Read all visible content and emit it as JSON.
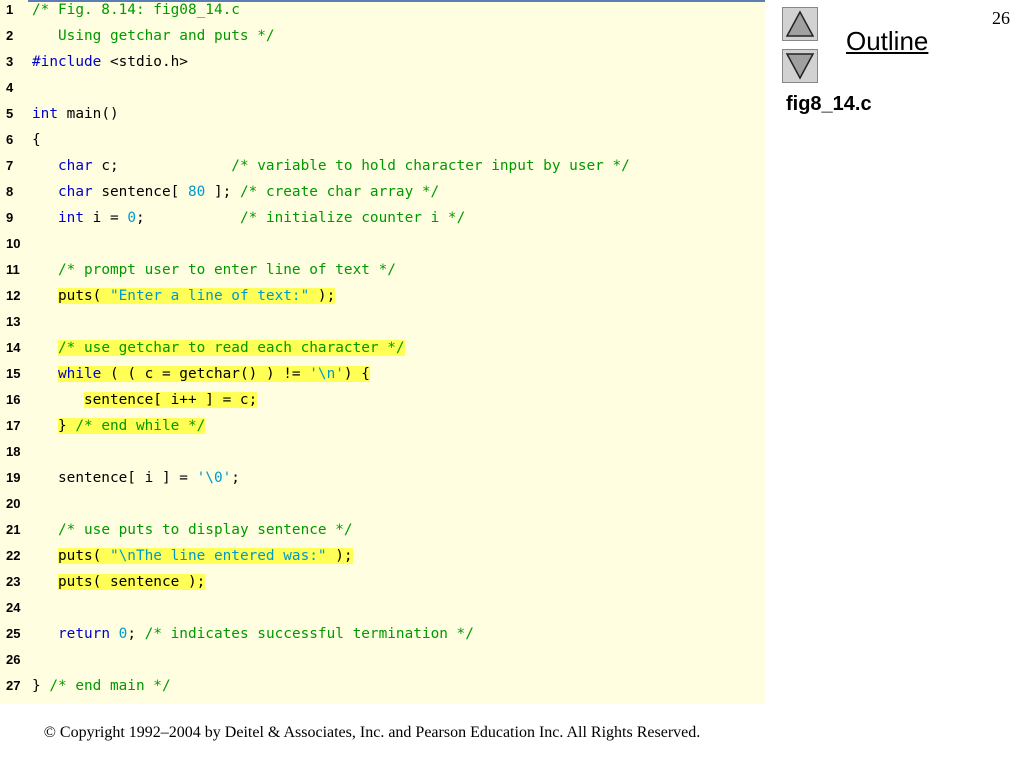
{
  "slide_number": "26",
  "outline": {
    "label": "Outline",
    "up_icon": "up-triangle-icon",
    "down_icon": "down-triangle-icon"
  },
  "file_label": "fig8_14.c",
  "copyright": "© Copyright 1992–2004 by Deitel & Associates, Inc. and Pearson Education Inc. All Rights Reserved.",
  "colors": {
    "panel": "#fffee0",
    "highlight": "#ffff55",
    "keyword": "#0000cc",
    "comment": "#009900",
    "literal": "#0099cc"
  },
  "code": {
    "lines": [
      {
        "n": "1",
        "hl": false,
        "tokens": [
          {
            "t": "cm",
            "v": "/* Fig. 8.14: fig08_14.c"
          }
        ]
      },
      {
        "n": "2",
        "hl": false,
        "tokens": [
          {
            "t": "cm",
            "v": "   Using getchar and puts */"
          }
        ]
      },
      {
        "n": "3",
        "hl": false,
        "tokens": [
          {
            "t": "kw",
            "v": "#include"
          },
          {
            "t": "tx",
            "v": " <stdio.h>"
          }
        ]
      },
      {
        "n": "4",
        "hl": false,
        "tokens": []
      },
      {
        "n": "5",
        "hl": false,
        "tokens": [
          {
            "t": "kw",
            "v": "int"
          },
          {
            "t": "tx",
            "v": " main()"
          }
        ]
      },
      {
        "n": "6",
        "hl": false,
        "tokens": [
          {
            "t": "tx",
            "v": "{"
          }
        ]
      },
      {
        "n": "7",
        "hl": false,
        "tokens": [
          {
            "t": "tx",
            "v": "   "
          },
          {
            "t": "kw",
            "v": "char"
          },
          {
            "t": "tx",
            "v": " c;             "
          },
          {
            "t": "cm",
            "v": "/* variable to hold character input by user */"
          }
        ]
      },
      {
        "n": "8",
        "hl": false,
        "tokens": [
          {
            "t": "tx",
            "v": "   "
          },
          {
            "t": "kw",
            "v": "char"
          },
          {
            "t": "tx",
            "v": " sentence[ "
          },
          {
            "t": "lit",
            "v": "80"
          },
          {
            "t": "tx",
            "v": " ]; "
          },
          {
            "t": "cm",
            "v": "/* create char array */"
          }
        ]
      },
      {
        "n": "9",
        "hl": false,
        "tokens": [
          {
            "t": "tx",
            "v": "   "
          },
          {
            "t": "kw",
            "v": "int"
          },
          {
            "t": "tx",
            "v": " i = "
          },
          {
            "t": "lit",
            "v": "0"
          },
          {
            "t": "tx",
            "v": ";           "
          },
          {
            "t": "cm",
            "v": "/* initialize counter i */"
          }
        ]
      },
      {
        "n": "10",
        "hl": false,
        "tokens": []
      },
      {
        "n": "11",
        "hl": false,
        "tokens": [
          {
            "t": "tx",
            "v": "   "
          },
          {
            "t": "cm",
            "v": "/* prompt user to enter line of text */"
          }
        ]
      },
      {
        "n": "12",
        "hl": true,
        "tokens": [
          {
            "t": "tx",
            "v": "   puts( "
          },
          {
            "t": "lit",
            "v": "\"Enter a line of text:\""
          },
          {
            "t": "tx",
            "v": " );"
          }
        ]
      },
      {
        "n": "13",
        "hl": false,
        "tokens": []
      },
      {
        "n": "14",
        "hl": true,
        "tokens": [
          {
            "t": "tx",
            "v": "   "
          },
          {
            "t": "cm",
            "v": "/* use getchar to read each character */"
          }
        ]
      },
      {
        "n": "15",
        "hl": true,
        "tokens": [
          {
            "t": "tx",
            "v": "   "
          },
          {
            "t": "kw",
            "v": "while"
          },
          {
            "t": "tx",
            "v": " ( ( c = getchar() ) != "
          },
          {
            "t": "lit",
            "v": "'\\n'"
          },
          {
            "t": "tx",
            "v": ") {"
          }
        ]
      },
      {
        "n": "16",
        "hl": true,
        "tokens": [
          {
            "t": "tx",
            "v": "      sentence[ i++ ] = c;"
          }
        ]
      },
      {
        "n": "17",
        "hl": true,
        "tokens": [
          {
            "t": "tx",
            "v": "   } "
          },
          {
            "t": "cm",
            "v": "/* end while */"
          }
        ]
      },
      {
        "n": "18",
        "hl": false,
        "tokens": []
      },
      {
        "n": "19",
        "hl": false,
        "tokens": [
          {
            "t": "tx",
            "v": "   sentence[ i ] = "
          },
          {
            "t": "lit",
            "v": "'\\0'"
          },
          {
            "t": "tx",
            "v": ";"
          }
        ]
      },
      {
        "n": "20",
        "hl": false,
        "tokens": []
      },
      {
        "n": "21",
        "hl": false,
        "tokens": [
          {
            "t": "tx",
            "v": "   "
          },
          {
            "t": "cm",
            "v": "/* use puts to display sentence */"
          }
        ]
      },
      {
        "n": "22",
        "hl": true,
        "tokens": [
          {
            "t": "tx",
            "v": "   puts( "
          },
          {
            "t": "lit",
            "v": "\"\\nThe line entered was:\""
          },
          {
            "t": "tx",
            "v": " );"
          }
        ]
      },
      {
        "n": "23",
        "hl": true,
        "tokens": [
          {
            "t": "tx",
            "v": "   puts( sentence );"
          }
        ]
      },
      {
        "n": "24",
        "hl": false,
        "tokens": []
      },
      {
        "n": "25",
        "hl": false,
        "tokens": [
          {
            "t": "tx",
            "v": "   "
          },
          {
            "t": "kw",
            "v": "return"
          },
          {
            "t": "tx",
            "v": " "
          },
          {
            "t": "lit",
            "v": "0"
          },
          {
            "t": "tx",
            "v": "; "
          },
          {
            "t": "cm",
            "v": "/* indicates successful termination */"
          }
        ]
      },
      {
        "n": "26",
        "hl": false,
        "tokens": []
      },
      {
        "n": "27",
        "hl": false,
        "tokens": [
          {
            "t": "tx",
            "v": "} "
          },
          {
            "t": "cm",
            "v": "/* end main */"
          }
        ]
      }
    ]
  }
}
